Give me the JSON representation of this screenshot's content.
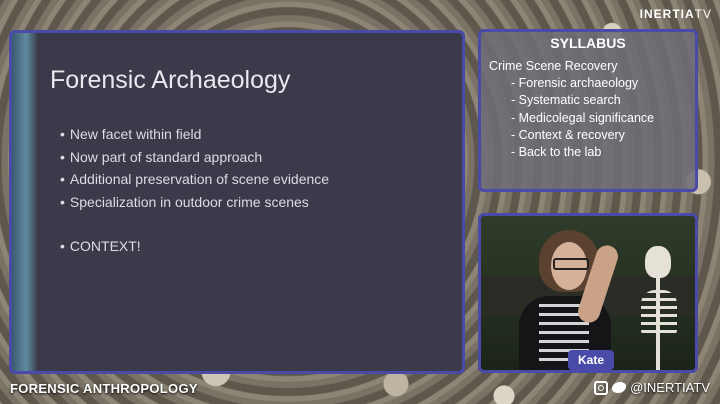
{
  "brand": {
    "part1": "INERTIA",
    "part2": "TV"
  },
  "slide": {
    "title": "Forensic Archaeology",
    "bullets": [
      "New facet within field",
      "Now part of standard approach",
      "Additional preservation of scene evidence",
      "Specialization in outdoor crime scenes",
      "CONTEXT!"
    ]
  },
  "syllabus": {
    "heading": "SYLLABUS",
    "section": "Crime Scene Recovery",
    "items": [
      "Forensic archaeology",
      "Systematic search",
      "Medicolegal significance",
      "Context & recovery",
      "Back to the lab"
    ]
  },
  "webcam": {
    "name": "Kate"
  },
  "footer": {
    "course": "FORENSIC ANTHROPOLOGY",
    "handle": "@INERTIATV"
  },
  "colors": {
    "panel_border": "#4a4aa8",
    "slide_bg": "#3a3a4a"
  }
}
